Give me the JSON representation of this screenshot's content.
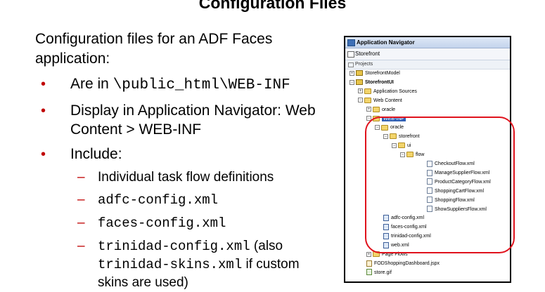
{
  "slide": {
    "title": "Configuration Files",
    "intro": "Configuration files for an ADF Faces application:",
    "bullet_marks": [
      "•",
      "•",
      "•"
    ],
    "bullets": [
      {
        "text_prefix": "Are in ",
        "mono": "\\public_html\\WEB-INF"
      },
      {
        "text": "Display in Application Navigator: Web Content > WEB-INF"
      },
      {
        "text": "Include:"
      }
    ],
    "sub_mark": "–",
    "sub_items": [
      {
        "text": "Individual task flow definitions"
      },
      {
        "mono": "adfc-config.xml"
      },
      {
        "mono": "faces-config.xml"
      },
      {
        "mono": "trinidad-config.xml",
        "text_after": " (also"
      },
      {
        "mono": "trinidad-skins.xml",
        "text_after": " if custom"
      },
      {
        "text": "skins are used)"
      }
    ]
  },
  "navigator": {
    "title": "Application Navigator",
    "toolbar_label": "Storefront",
    "projects_label": "Projects",
    "tree": [
      {
        "label": "StorefrontModel",
        "icon": "project",
        "expander": "+"
      },
      {
        "label": "StorefrontUI",
        "icon": "project",
        "expander": "−",
        "bold": true
      },
      {
        "label": "Application Sources",
        "icon": "folder",
        "expander": "+"
      },
      {
        "label": "Web Content",
        "icon": "folder",
        "expander": "−"
      },
      {
        "label": "oracle",
        "icon": "folder",
        "expander": "+"
      },
      {
        "label": "WEB-INF",
        "icon": "folder",
        "expander": "−",
        "selected": true
      },
      {
        "label": "oracle",
        "icon": "folder",
        "expander": "−"
      },
      {
        "label": "storefront",
        "icon": "folder",
        "expander": "−"
      },
      {
        "label": "ui",
        "icon": "folder",
        "expander": "−"
      },
      {
        "label": "flow",
        "icon": "folder",
        "expander": "−"
      },
      {
        "label": "CheckoutFlow.xml",
        "icon": "xml"
      },
      {
        "label": "ManageSupplierFlow.xml",
        "icon": "xml"
      },
      {
        "label": "ProductCategoryFlow.xml",
        "icon": "xml"
      },
      {
        "label": "ShoppingCartFlow.xml",
        "icon": "xml"
      },
      {
        "label": "ShoppingFlow.xml",
        "icon": "xml"
      },
      {
        "label": "ShowSuppliersFlow.xml",
        "icon": "xml"
      },
      {
        "label": "adfc-config.xml",
        "icon": "xml-b"
      },
      {
        "label": "faces-config.xml",
        "icon": "xml-b"
      },
      {
        "label": "trinidad-config.xml",
        "icon": "xml-b"
      },
      {
        "label": "web.xml",
        "icon": "xml-b"
      },
      {
        "label": "Page Flows",
        "icon": "folder",
        "expander": "+"
      },
      {
        "label": "FODShoppingDashboard.jspx",
        "icon": "jspx"
      },
      {
        "label": "store.gif",
        "icon": "gif"
      }
    ]
  },
  "colors": {
    "bullet": "#c00000",
    "highlight": "#e0121c",
    "selection": "#2f5fb3"
  }
}
